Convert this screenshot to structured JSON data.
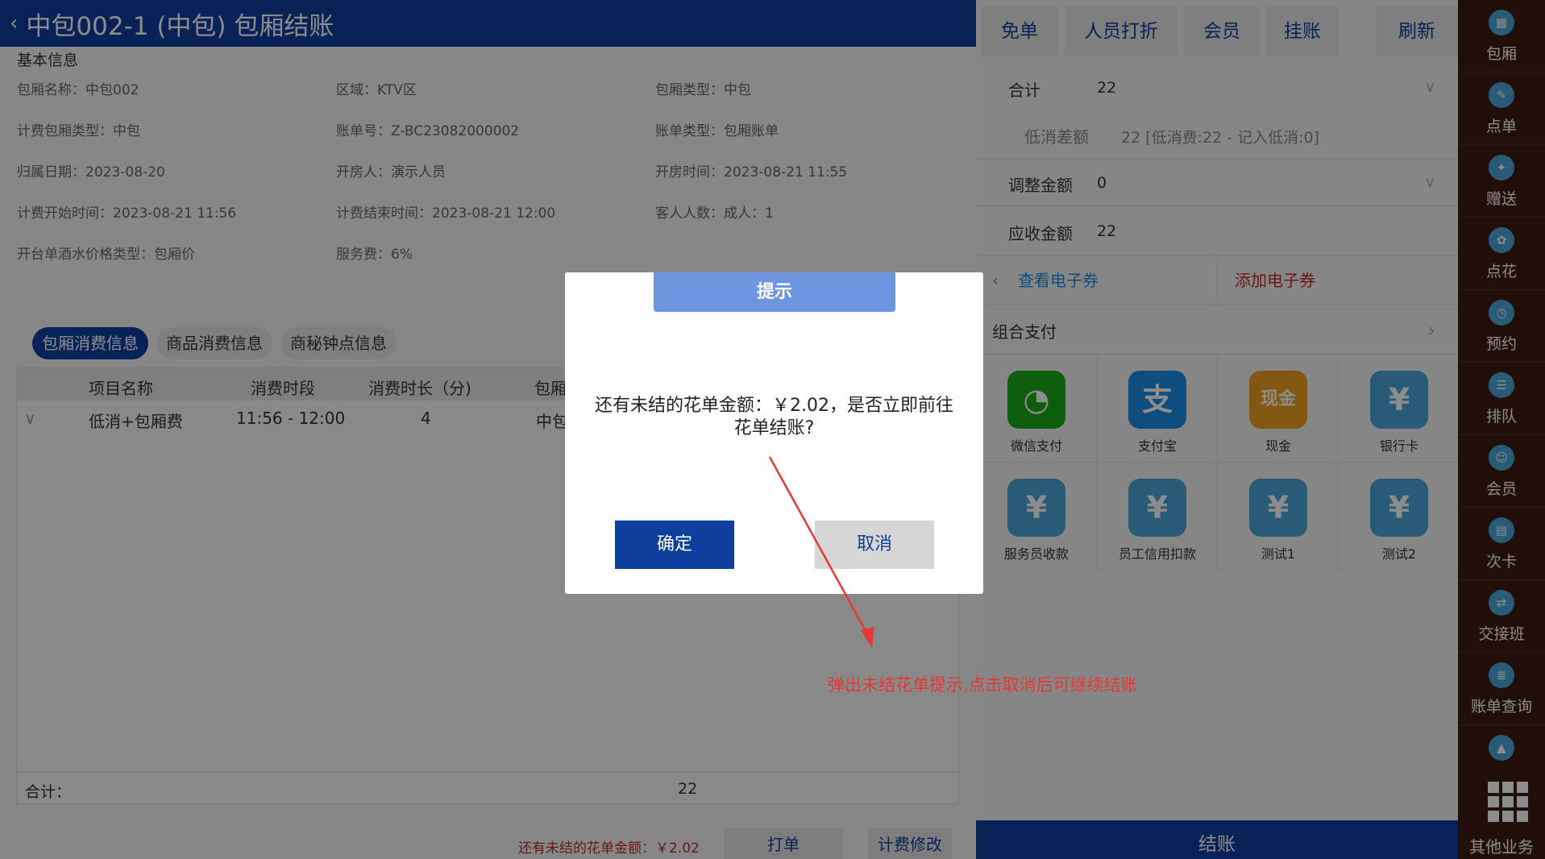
{
  "header": {
    "back_icon": "‹",
    "title": "中包002-1 (中包) 包厢结账"
  },
  "basic": {
    "section_title": "基本信息",
    "fields": [
      "包厢名称：中包002",
      "区域：KTV区",
      "包厢类型：中包",
      "计费包厢类型：中包",
      "账单号：Z-BC23082000002",
      "账单类型：包厢账单",
      "归属日期：2023-08-20",
      "开房人：演示人员",
      "开房时间：2023-08-21 11:55",
      "计费开始时间：2023-08-21 11:56",
      "计费结束时间：2023-08-21 12:00",
      "客人人数：成人：1",
      "开台单酒水价格类型：包厢价",
      "服务费：6%"
    ]
  },
  "tabs": [
    "包厢消费信息",
    "商品消费信息",
    "商秘钟点信息"
  ],
  "table": {
    "headers": [
      "项目名称",
      "消费时段",
      "消费时长（分)",
      "包厢"
    ],
    "row": {
      "expand_icon": "∨",
      "name": "低消+包厢费",
      "period": "11:56 - 12:00",
      "duration": "4",
      "room": "中包"
    },
    "footer_label": "合计：",
    "footer_value": "22"
  },
  "bottom": {
    "pending": "还有未结的花单金额：￥2.02",
    "print_btn": "打单",
    "fee_btn": "计费修改"
  },
  "right": {
    "top_buttons": [
      "免单",
      "人员打折",
      "会员",
      "挂账",
      "刷新"
    ],
    "total_label": "合计",
    "total_value": "22",
    "min_diff_label": "低消差额",
    "min_diff_value": "22 [低消费:22 - 记入低消:0]",
    "adjust_label": "调整金额",
    "adjust_value": "0",
    "receivable_label": "应收金额",
    "receivable_value": "22",
    "view_coupon": "查看电子券",
    "add_coupon": "添加电子券",
    "combo_pay": "组合支付",
    "payments": [
      {
        "label": "微信支付",
        "icon": "wechat-icon",
        "glyph": "◔",
        "color": "#1aad19"
      },
      {
        "label": "支付宝",
        "icon": "alipay-icon",
        "glyph": "支",
        "color": "#1a8ce6"
      },
      {
        "label": "现金",
        "icon": "cash-icon",
        "glyph": "现金",
        "color": "#f0a020"
      },
      {
        "label": "银行卡",
        "icon": "yen-icon",
        "glyph": "¥",
        "color": "#4aa6d8"
      },
      {
        "label": "服务员收款",
        "icon": "yen-icon",
        "glyph": "¥",
        "color": "#4aa6d8"
      },
      {
        "label": "员工信用扣款",
        "icon": "yen-icon",
        "glyph": "¥",
        "color": "#4aa6d8"
      },
      {
        "label": "测试1",
        "icon": "yen-icon",
        "glyph": "¥",
        "color": "#4aa6d8"
      },
      {
        "label": "测试2",
        "icon": "yen-icon",
        "glyph": "¥",
        "color": "#4aa6d8"
      }
    ],
    "checkout": "结账"
  },
  "sidebar": {
    "items": [
      {
        "label": "包厢",
        "icon": "grid-icon"
      },
      {
        "label": "点单",
        "icon": "order-icon"
      },
      {
        "label": "赠送",
        "icon": "gift-icon"
      },
      {
        "label": "点花",
        "icon": "flower-icon"
      },
      {
        "label": "预约",
        "icon": "reserve-icon"
      },
      {
        "label": "排队",
        "icon": "queue-icon"
      },
      {
        "label": "会员",
        "icon": "member-icon"
      },
      {
        "label": "次卡",
        "icon": "card-icon"
      },
      {
        "label": "交接班",
        "icon": "shift-icon"
      },
      {
        "label": "账单查询",
        "icon": "bill-icon"
      }
    ],
    "other": "其他业务"
  },
  "dialog": {
    "title": "提示",
    "message": "还有未结的花单金额：￥2.02，是否立即前往花单结账?",
    "ok": "确定",
    "cancel": "取消"
  },
  "annotation": "弹出未结花单提示,点击取消后可继续结账"
}
